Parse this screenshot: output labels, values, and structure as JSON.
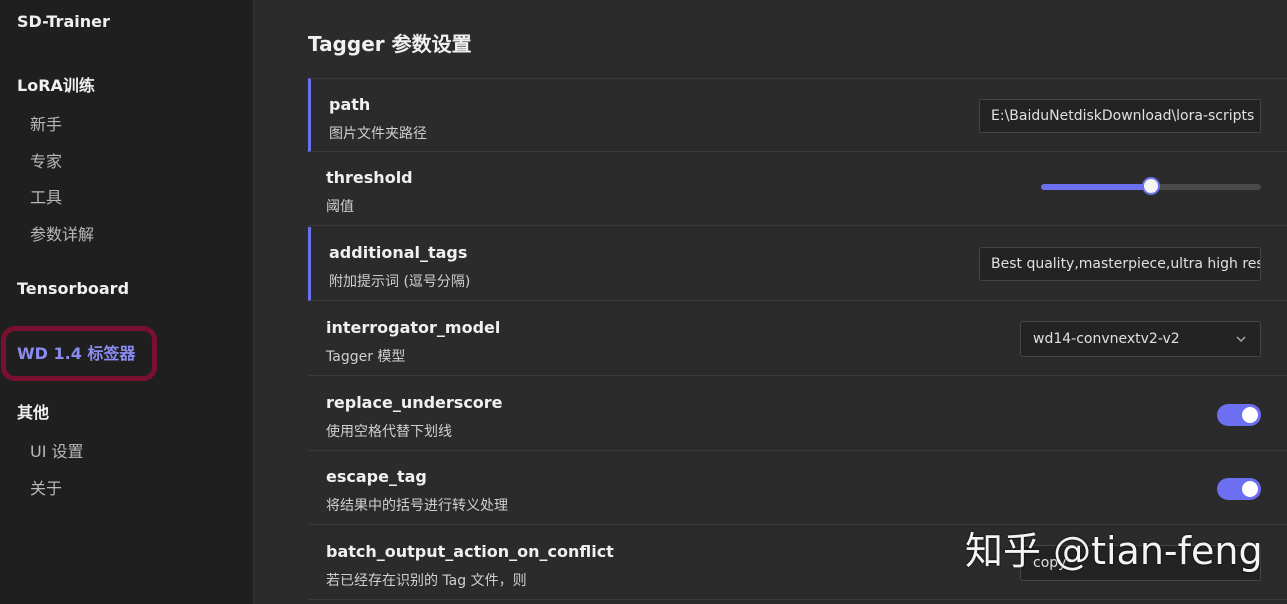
{
  "sidebar": {
    "app_title": "SD-Trainer",
    "section_lora": "LoRA训练",
    "lora_items": [
      "新手",
      "专家",
      "工具",
      "参数详解"
    ],
    "section_tensorboard": "Tensorboard",
    "section_wd": "WD 1.4 标签器",
    "section_other": "其他",
    "other_items": [
      "UI 设置",
      "关于"
    ]
  },
  "main": {
    "title": "Tagger 参数设置",
    "rows": [
      {
        "name": "path",
        "desc": "图片文件夹路径",
        "value": "E:\\BaiduNetdiskDownload\\lora-scripts"
      },
      {
        "name": "threshold",
        "desc": "阈值",
        "value_fraction": 0.5
      },
      {
        "name": "additional_tags",
        "desc": "附加提示词 (逗号分隔)",
        "value": "Best quality,masterpiece,ultra high res"
      },
      {
        "name": "interrogator_model",
        "desc": "Tagger 模型",
        "value": "wd14-convnextv2-v2"
      },
      {
        "name": "replace_underscore",
        "desc": "使用空格代替下划线",
        "enabled": true
      },
      {
        "name": "escape_tag",
        "desc": "将结果中的括号进行转义处理",
        "enabled": true
      },
      {
        "name": "batch_output_action_on_conflict",
        "desc": "若已经存在识别的 Tag 文件，则",
        "value": "copy"
      }
    ]
  },
  "watermark": "知乎 @tian-feng",
  "colors": {
    "accent": "#6c6ff0",
    "highlight_ring": "#7a1030"
  },
  "icons": {
    "select_arrow": "chevron-down-icon"
  }
}
